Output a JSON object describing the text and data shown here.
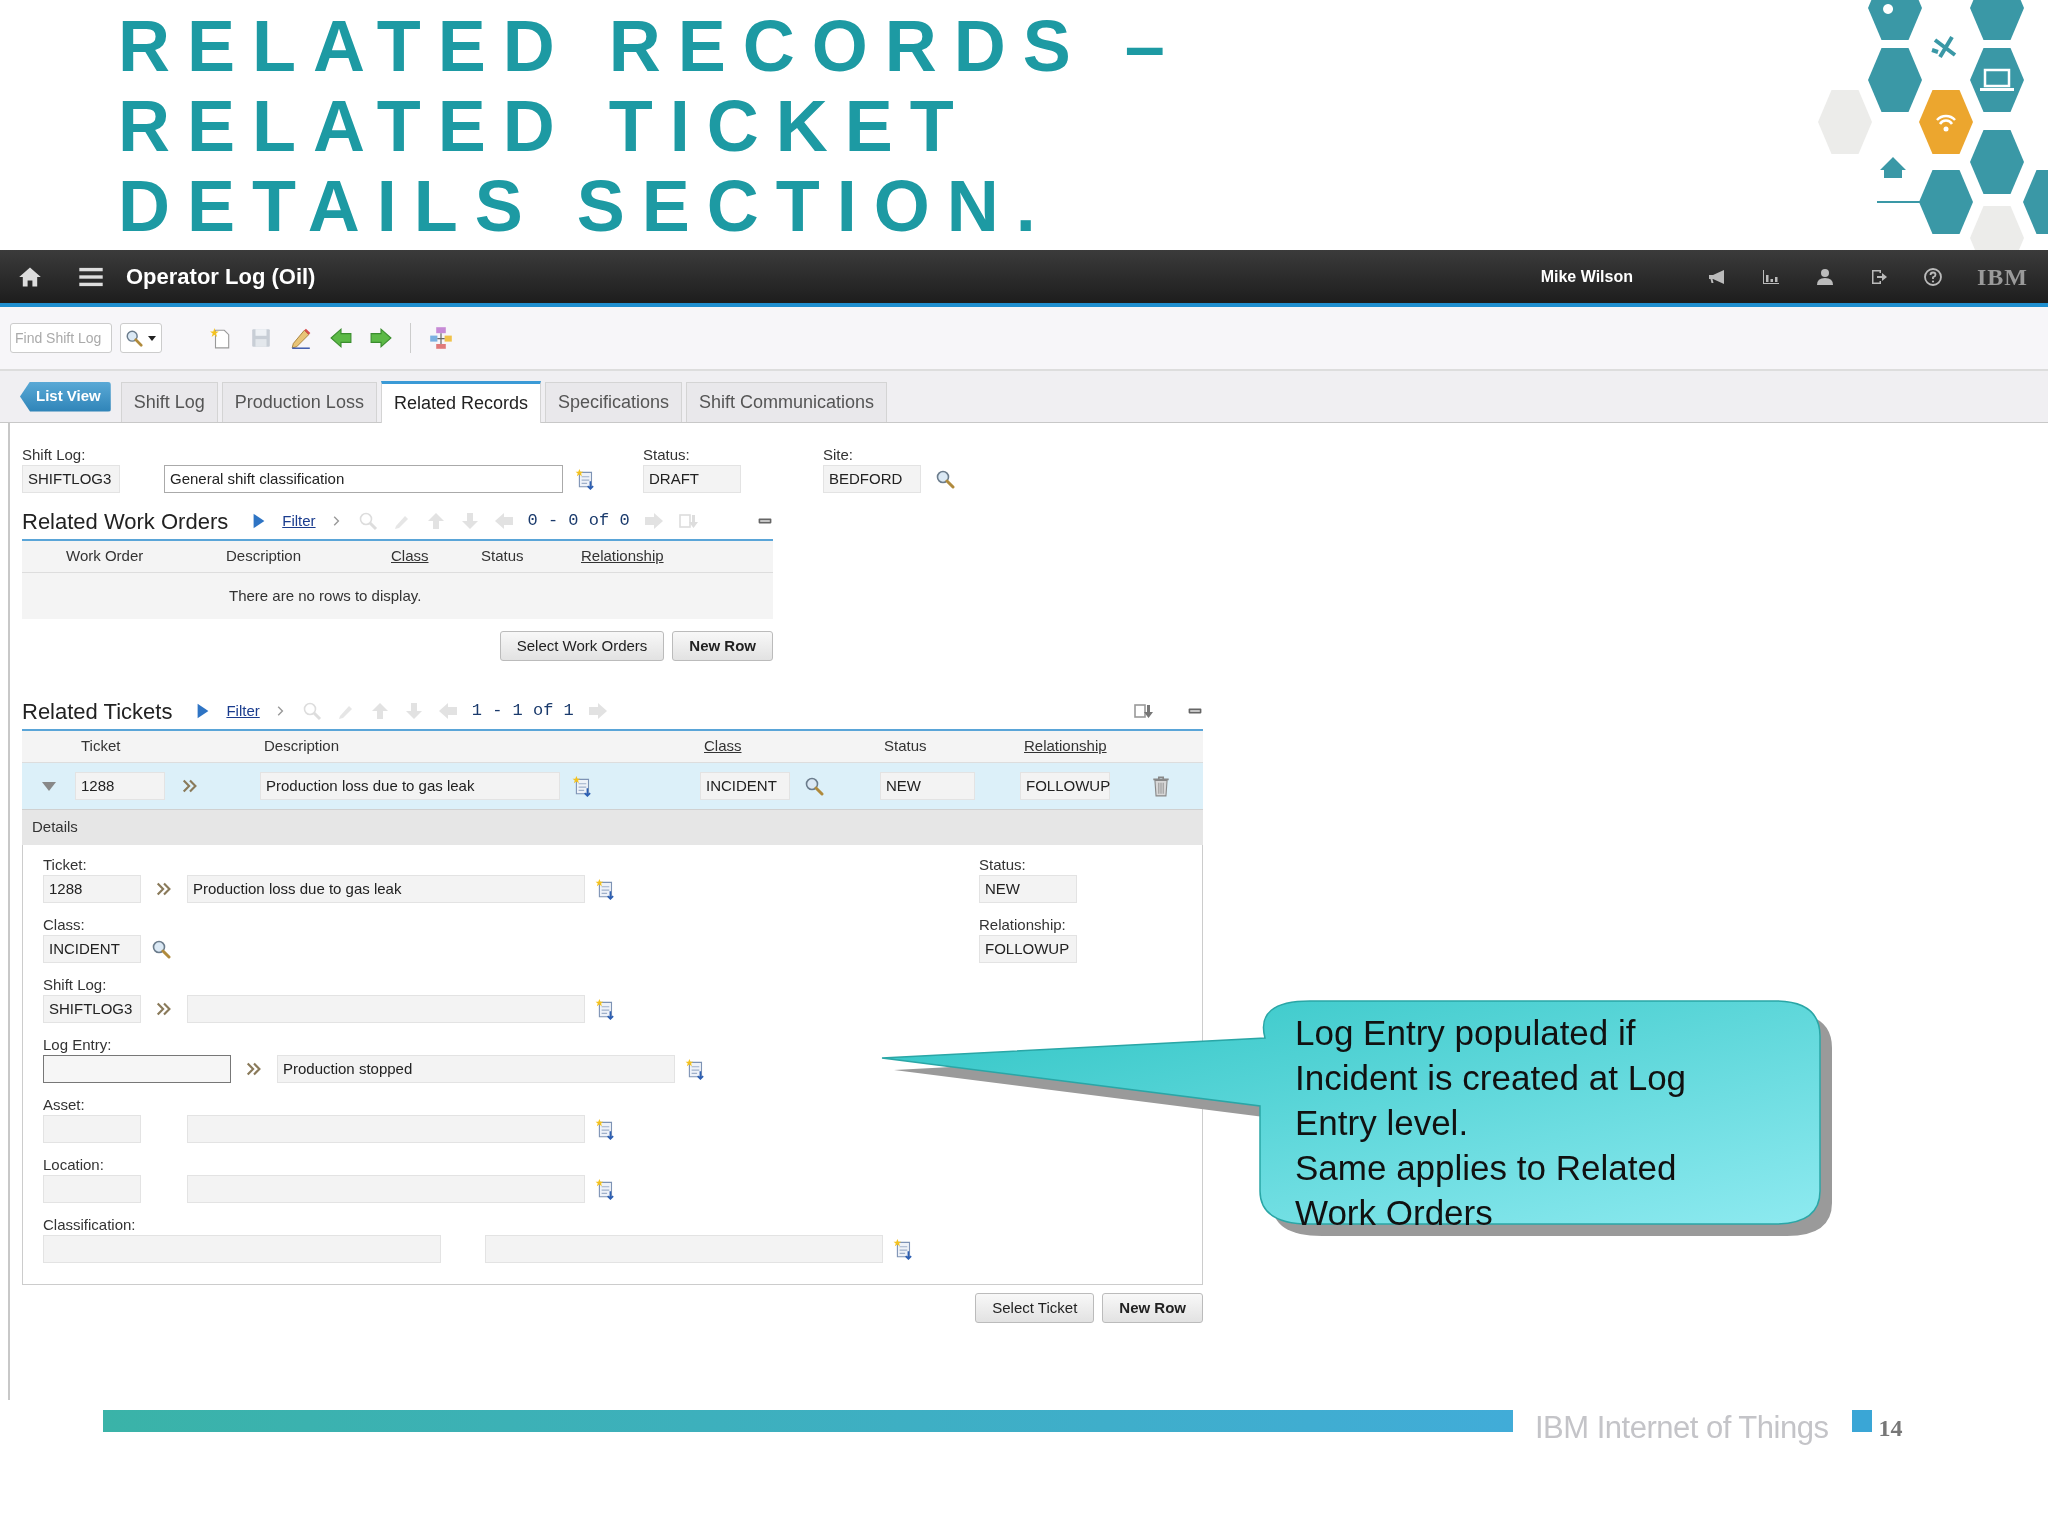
{
  "slide": {
    "title_lines": [
      "RELATED RECORDS –",
      "RELATED TICKET",
      "DETAILS SECTION."
    ],
    "footer": "IBM Internet of Things",
    "page_number": "14"
  },
  "app": {
    "title": "Operator Log (Oil)",
    "user": "Mike Wilson",
    "logo": "IBM",
    "search": {
      "placeholder": "Find Shift Log"
    },
    "tabs": [
      {
        "label": "List View",
        "kind": "back",
        "selected": false
      },
      {
        "label": "Shift Log",
        "kind": "tab",
        "selected": false
      },
      {
        "label": "Production Loss",
        "kind": "tab",
        "selected": false
      },
      {
        "label": "Related Records",
        "kind": "tab",
        "selected": true
      },
      {
        "label": "Specifications",
        "kind": "tab",
        "selected": false
      },
      {
        "label": "Shift Communications",
        "kind": "tab",
        "selected": false
      }
    ],
    "header_fields": [
      {
        "label": "Shift Log:",
        "value": "SHIFTLOG3",
        "description": "General shift classification"
      },
      {
        "label": "Status:",
        "value": "DRAFT"
      },
      {
        "label": "Site:",
        "value": "BEDFORD",
        "lookup": true
      }
    ],
    "work_orders": {
      "title": "Related Work Orders",
      "filter": "Filter",
      "pager": "0 - 0 of 0",
      "columns": [
        {
          "label": "Work Order",
          "link": false
        },
        {
          "label": "Description",
          "link": false
        },
        {
          "label": "Class",
          "link": true
        },
        {
          "label": "Status",
          "link": false
        },
        {
          "label": "Relationship",
          "link": true
        }
      ],
      "empty": "There are no rows to display.",
      "buttons": [
        {
          "label": "Select Work Orders",
          "default": false
        },
        {
          "label": "New Row",
          "default": true
        }
      ]
    },
    "tickets": {
      "title": "Related Tickets",
      "filter": "Filter",
      "pager": "1 - 1 of 1",
      "columns": [
        {
          "label": "Ticket",
          "link": false
        },
        {
          "label": "Description",
          "link": false
        },
        {
          "label": "Class",
          "link": true
        },
        {
          "label": "Status",
          "link": false
        },
        {
          "label": "Relationship",
          "link": true
        }
      ],
      "rows": [
        {
          "ticket": "1288",
          "description": "Production loss due to gas leak",
          "class": "INCIDENT",
          "status": "NEW",
          "relationship": "FOLLOWUP",
          "selected": true,
          "expanded": true
        }
      ],
      "details": {
        "title": "Details",
        "fields": [
          {
            "label": "Ticket:",
            "kind": "linked",
            "value": "1288",
            "description": "Production loss due to gas leak",
            "focused": false
          },
          {
            "label": "Class:",
            "kind": "lookup",
            "value": "INCIDENT",
            "focused": false
          },
          {
            "label": "Shift Log:",
            "kind": "linked",
            "value": "SHIFTLOG3",
            "focused": false
          },
          {
            "label": "Log Entry:",
            "kind": "linked_wide",
            "description": "Production stopped",
            "focused": true
          },
          {
            "label": "Asset:",
            "kind": "described",
            "focused": false
          },
          {
            "label": "Location:",
            "kind": "described",
            "focused": false
          },
          {
            "label": "Classification:",
            "kind": "wide",
            "focused": false
          }
        ],
        "side_fields": [
          {
            "label": "Status:",
            "value": "NEW"
          },
          {
            "label": "Relationship:",
            "value": "FOLLOWUP"
          }
        ]
      },
      "buttons": [
        {
          "label": "Select Ticket",
          "default": false
        },
        {
          "label": "New Row",
          "default": true
        }
      ]
    }
  },
  "callout": {
    "paragraphs": [
      "Log Entry populated if Incident is created at Log Entry level.",
      "Same applies to Related Work Orders"
    ]
  }
}
